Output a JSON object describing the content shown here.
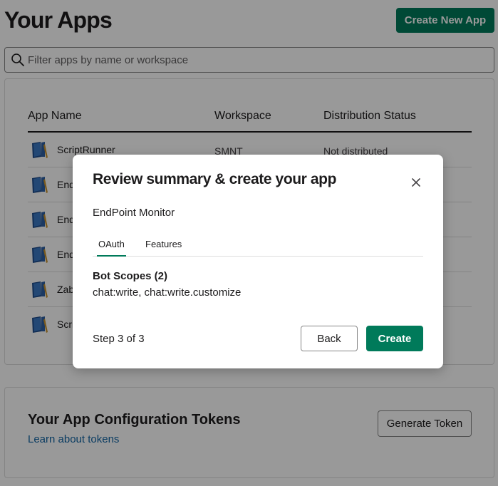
{
  "page": {
    "title": "Your Apps",
    "create_app_label": "Create New App",
    "filter_placeholder": "Filter apps by name or workspace"
  },
  "apps_table": {
    "headers": [
      "App Name",
      "Workspace",
      "Distribution Status"
    ],
    "rows": [
      {
        "name": "ScriptRunner",
        "workspace": "SMNT",
        "status": "Not distributed"
      },
      {
        "name": "End",
        "workspace": "",
        "status": ""
      },
      {
        "name": "End",
        "workspace": "",
        "status": ""
      },
      {
        "name": "End",
        "workspace": "",
        "status": ""
      },
      {
        "name": "Zab",
        "workspace": "",
        "status": ""
      },
      {
        "name": "Scri",
        "workspace": "",
        "status": ""
      }
    ]
  },
  "tokens": {
    "title": "Your App Configuration Tokens",
    "link": "Learn about tokens",
    "generate_label": "Generate Token"
  },
  "modal": {
    "title": "Review summary & create your app",
    "app_name": "EndPoint Monitor",
    "tabs": [
      {
        "label": "OAuth",
        "active": true
      },
      {
        "label": "Features",
        "active": false
      }
    ],
    "section_title": "Bot Scopes (2)",
    "section_body": "chat:write, chat:write.customize",
    "step": "Step 3 of 3",
    "back_label": "Back",
    "create_label": "Create"
  },
  "icons": {
    "search": "search-icon",
    "close": "close-icon",
    "app": "notebook-app-icon"
  },
  "colors": {
    "accent": "#007a5a",
    "link": "#1264a3",
    "overlay": "rgba(0,0,0,0.4)"
  }
}
